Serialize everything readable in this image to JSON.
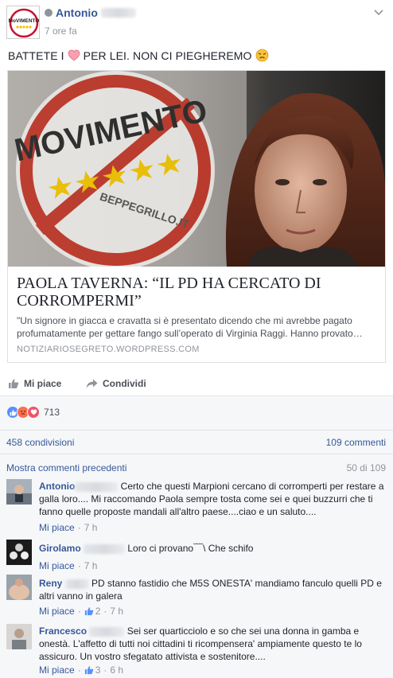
{
  "post": {
    "author": "Antonio",
    "time": "7 ore fa",
    "text_before": "BATTETE I",
    "text_after": "PER LEI. NON CI PIEGHEREMO"
  },
  "avatar_logo": {
    "text": "MoVIMENTO"
  },
  "image_logo": {
    "text": "MOVIMENTO",
    "subtext": "BEPPEGRILLO.IT"
  },
  "link": {
    "title": "PAOLA TAVERNA: “IL PD HA CERCATO DI CORROMPERMI”",
    "description": "\"Un signore in giacca e cravatta si è presentato dicendo che mi avrebbe pagato profumatamente per gettare fango sull’operato di Virginia Raggi. Hanno provato…",
    "source": "NOTIZIARIOSEGRETO.WORDPRESS.COM"
  },
  "actions": {
    "like": "Mi piace",
    "share": "Condividi"
  },
  "reactions": {
    "count": "713"
  },
  "stats": {
    "shares": "458 condivisioni",
    "comments": "109 commenti"
  },
  "previous": {
    "label": "Mostra commenti precedenti",
    "count": "50 di 109"
  },
  "comments": [
    {
      "name": "Antonio",
      "text": "Certo che questi Marpioni cercano di corromperti per restare a galla loro.... Mi raccomando Paola sempre tosta come sei e quei buzzurri che ti fanno quelle proposte mandali all'altro paese....ciao e un saluto....",
      "like": "Mi piace",
      "likes": "",
      "time": "7 h"
    },
    {
      "name": "Girolamo",
      "text": "Loro ci provano﹋\\ Che schifo",
      "like": "Mi piace",
      "likes": "",
      "time": "7 h"
    },
    {
      "name": "Reny",
      "text": "PD stanno fastidio che M5S ONESTA' mandiamo fanculo quelli PD e altri vanno in galera",
      "like": "Mi piace",
      "likes": "2",
      "time": "7 h"
    },
    {
      "name": "Francesco",
      "text": "Sei ser quarticciolo e so che sei una donna in gamba e onestà. L'affetto di tutti noi cittadini ti ricompensera' ampiamente questo te lo assicuro. Un vostro sfegatato attivista e sostenitore....",
      "like": "Mi piace",
      "likes": "3",
      "time": "6 h"
    }
  ],
  "colors": {
    "link_blue": "#365899",
    "meta_gray": "#90949c",
    "like_blue": "#5890ff",
    "heart_red": "#f25268",
    "angry_orange": "#f7714c"
  }
}
